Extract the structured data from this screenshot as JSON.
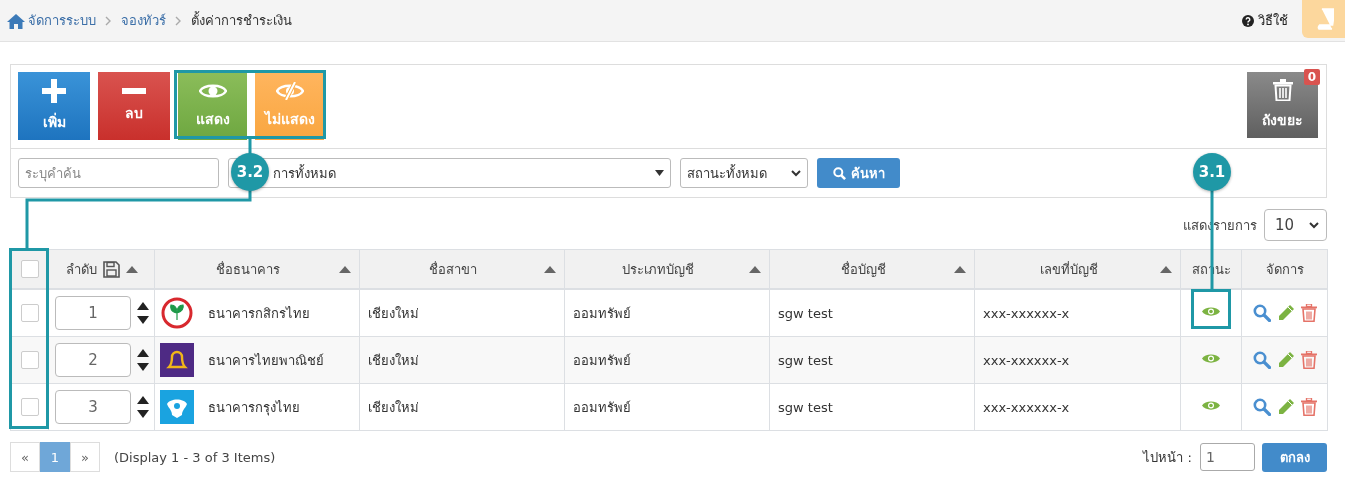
{
  "breadcrumb": [
    {
      "label": "จัดการระบบ",
      "kind": "home"
    },
    {
      "label": "จองทัวร์",
      "kind": "link"
    },
    {
      "label": "ตั้งค่าการชำระเงิน",
      "kind": "current"
    }
  ],
  "help": "วิธีใช้",
  "toolbar": [
    {
      "label": "เพิ่ม",
      "kind": "add"
    },
    {
      "label": "ลบ",
      "kind": "delete"
    },
    {
      "label": "แสดง",
      "kind": "show"
    },
    {
      "label": "ไม่แสดง",
      "kind": "hide"
    }
  ],
  "trash": {
    "label": "ถังขยะ",
    "count": "0"
  },
  "filter": {
    "search": {
      "placeholder": "ระบุคำค้น"
    },
    "category": "การทั้งหมด",
    "status": "สถานะทั้งหมด",
    "button": "ค้นหา"
  },
  "page_size": {
    "label": "แสดงรายการ",
    "value": "10"
  },
  "select_all": {
    "checked": false
  },
  "columns": [
    {
      "label": "ลำดับ",
      "sortable": true,
      "kind": "order"
    },
    {
      "label": "ชื่อธนาคาร",
      "sortable": true,
      "kind": "text"
    },
    {
      "label": "ชื่อสาขา",
      "sortable": true,
      "kind": "text"
    },
    {
      "label": "ประเภทบัญชี",
      "sortable": true,
      "kind": "text"
    },
    {
      "label": "ชื่อบัญชี",
      "sortable": true,
      "kind": "text"
    },
    {
      "label": "เลขที่บัญชี",
      "sortable": true,
      "kind": "text"
    },
    {
      "label": "สถานะ",
      "sortable": false,
      "kind": "text"
    },
    {
      "label": "จัดการ",
      "sortable": false,
      "kind": "text"
    }
  ],
  "rows": [
    {
      "selected": false,
      "order": "1",
      "kind": "leaf",
      "bank": "ธนาคารกสิกรไทย",
      "branch": "เชียงใหม่",
      "type": "ออมทรัพย์",
      "account_name": "sgw test",
      "account_no": "xxx-xxxxxx-x",
      "visible": true
    },
    {
      "selected": false,
      "order": "2",
      "kind": "bell",
      "bank": "ธนาคารไทยพาณิชย์",
      "branch": "เชียงใหม่",
      "type": "ออมทรัพย์",
      "account_name": "sgw test",
      "account_no": "xxx-xxxxxx-x",
      "visible": true
    },
    {
      "selected": false,
      "order": "3",
      "kind": "bird",
      "bank": "ธนาคารกรุงไทย",
      "branch": "เชียงใหม่",
      "type": "ออมทรัพย์",
      "account_name": "sgw test",
      "account_no": "xxx-xxxxxx-x",
      "visible": true
    }
  ],
  "pagination": {
    "prev": "«",
    "pages": [
      {
        "label": "1",
        "selected": true
      }
    ],
    "next": "»",
    "summary": "(Display 1 - 3 of 3 Items)"
  },
  "goto": {
    "label": "ไปหน้า  :",
    "value": "1",
    "button": "ตกลง"
  },
  "annotations": [
    {
      "label": "3.2",
      "kind": "toolbar"
    },
    {
      "label": "3.1",
      "kind": "status"
    }
  ]
}
